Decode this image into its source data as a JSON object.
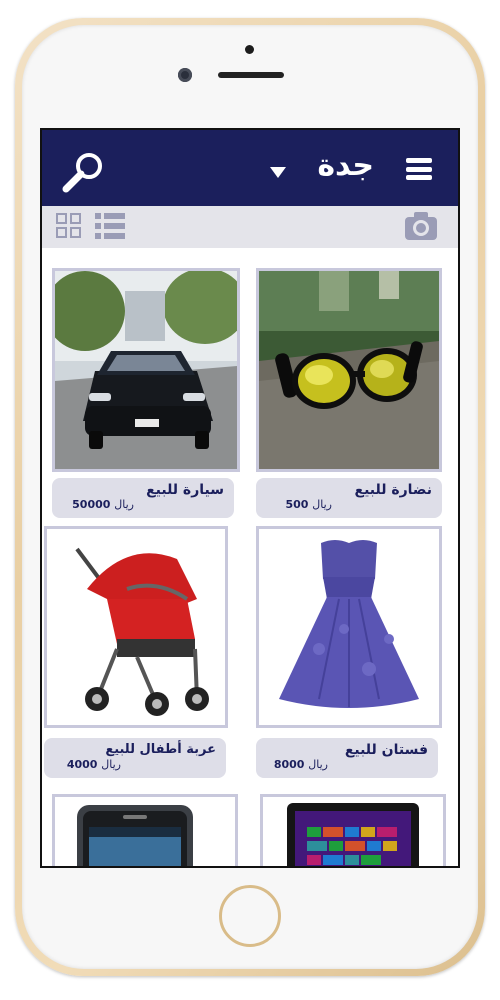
{
  "header": {
    "city": "جدة",
    "icons": {
      "menu": "hamburger-menu-icon",
      "dropdown": "dropdown-arrow-icon",
      "search": "search-icon"
    }
  },
  "toolbar": {
    "icons": {
      "grid": "grid-view-icon",
      "list": "list-view-icon",
      "camera": "camera-icon"
    }
  },
  "colors": {
    "header_bg": "#1b1f5c",
    "toolbar_bg": "#e4e4ea",
    "card_border": "#c8c8dc",
    "info_bg": "#dedee8"
  },
  "listings": [
    {
      "title": "نضارة للبيع",
      "currency": "ريال",
      "price": "500",
      "image": "sunglasses-photo"
    },
    {
      "title": "سيارة للبيع",
      "currency": "ريال",
      "price": "50000",
      "image": "black-car-photo"
    },
    {
      "title": "فستان للبيع",
      "currency": "ريال",
      "price": "8000",
      "image": "blue-dress-photo"
    },
    {
      "title": "عربة أطفال للبيع",
      "currency": "ريال",
      "price": "4000",
      "image": "red-stroller-photo"
    },
    {
      "title": "",
      "currency": "",
      "price": "",
      "image": "windows-tablet-photo"
    },
    {
      "title": "",
      "currency": "",
      "price": "",
      "image": "samsung-phone-photo"
    }
  ]
}
